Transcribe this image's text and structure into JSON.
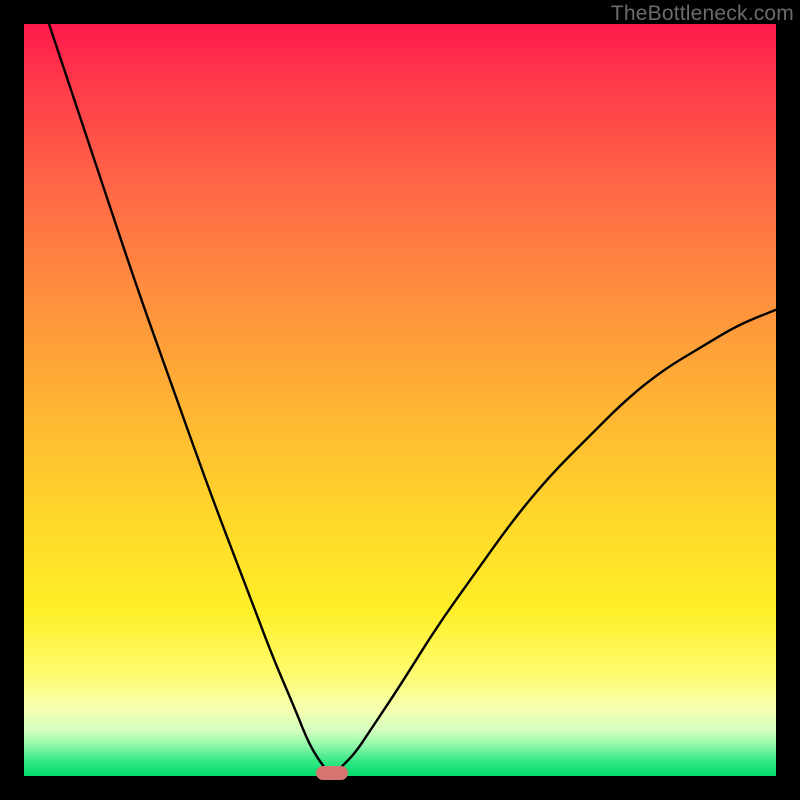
{
  "watermark": "TheBottleneck.com",
  "colors": {
    "frame": "#000000",
    "gradient_top": "#ff1a4d",
    "gradient_bottom": "#00da6e",
    "curve": "#000000",
    "marker": "#d6756f",
    "watermark_text": "#6b6b6b"
  },
  "chart_data": {
    "type": "line",
    "title": "",
    "xlabel": "",
    "ylabel": "",
    "x_range": [
      0,
      100
    ],
    "y_range": [
      0,
      100
    ],
    "grid": false,
    "legend": false,
    "notes": "V-shaped bottleneck curve with minimum at x≈41. Left branch steeper than right branch. Right branch exits top edge at x≈100,y≈62. Background is vertical red→green gradient.",
    "optimum_x": 41,
    "optimum_y": 0,
    "marker": {
      "x": 41,
      "y": 0,
      "shape": "rounded-rect"
    },
    "series": [
      {
        "name": "bottleneck-curve",
        "x": [
          0,
          5,
          10,
          15,
          20,
          25,
          30,
          33,
          36,
          38,
          40,
          41,
          42,
          44,
          46,
          50,
          55,
          60,
          65,
          70,
          75,
          80,
          85,
          90,
          95,
          100
        ],
        "y": [
          110,
          95,
          80,
          65,
          51,
          37,
          24,
          16,
          9,
          4,
          1,
          0,
          1,
          3,
          6,
          12,
          20,
          27,
          34,
          40,
          45,
          50,
          54,
          57,
          60,
          62
        ]
      }
    ]
  }
}
